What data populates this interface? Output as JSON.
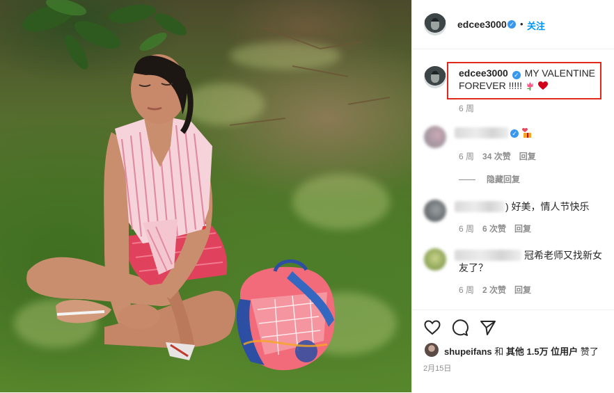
{
  "post": {
    "author": "edcee3000",
    "follow_label": "关注",
    "dot": "•",
    "verified_icon": "verified-badge-icon",
    "caption": {
      "username": "edcee3000",
      "text_line1": "MY VALENTINE",
      "text_line2": "FOREVER !!!!!",
      "emojis": [
        "tulip-icon",
        "red-heart-icon"
      ],
      "time": "6 周"
    },
    "comments": [
      {
        "text": "",
        "emoji": "gift-hearts-icon",
        "time": "6 周",
        "likes": "34 次赞",
        "reply": "回复",
        "hidden_replies": "隐藏回复"
      },
      {
        "text": "好美，情人节快乐",
        "partial_visible": ")",
        "time": "6 周",
        "likes": "6 次赞",
        "reply": "回复"
      },
      {
        "text_line1": "冠希老师又找新女",
        "text_line2": "友了？",
        "time": "6 周",
        "likes": "2 次赞",
        "reply": "回复"
      }
    ],
    "likes_line": {
      "user": "shupeifans",
      "and": "和",
      "others": "其他 1.5万 位用户",
      "suffix": "赞了"
    },
    "date": "2月15日"
  },
  "colors": {
    "accent": "#0095f6",
    "highlight": "#e0281b",
    "muted": "#8e8e8e",
    "text": "#262626"
  }
}
